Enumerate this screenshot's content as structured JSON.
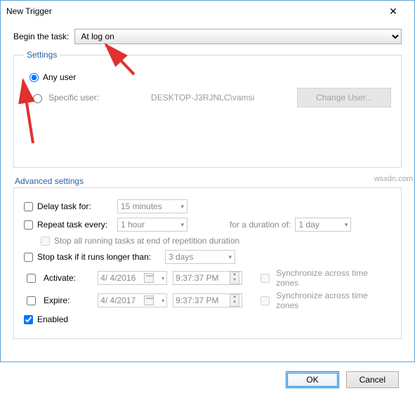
{
  "window": {
    "title": "New Trigger"
  },
  "begin": {
    "label": "Begin the task:",
    "selected": "At log on"
  },
  "settings": {
    "legend": "Settings",
    "any_user_label": "Any user",
    "any_user_checked": true,
    "specific_user_label": "Specific user:",
    "specific_user_checked": false,
    "specific_user_value": "DESKTOP-J3RJNLC\\vamsi",
    "change_user_label": "Change User..."
  },
  "advanced": {
    "legend": "Advanced settings",
    "delay": {
      "label": "Delay task for:",
      "checked": false,
      "value": "15 minutes"
    },
    "repeat": {
      "label": "Repeat task every:",
      "checked": false,
      "value": "1 hour",
      "duration_label": "for a duration of:",
      "duration_value": "1 day"
    },
    "stop_end_label": "Stop all running tasks at end of repetition duration",
    "stop_end_checked": false,
    "stop_longer": {
      "label": "Stop task if it runs longer than:",
      "checked": false,
      "value": "3 days"
    },
    "activate": {
      "label": "Activate:",
      "checked": false,
      "date": "4/  4/2016",
      "time": "9:37:37 PM",
      "sync_label": "Synchronize across time zones",
      "sync_checked": false
    },
    "expire": {
      "label": "Expire:",
      "checked": false,
      "date": "4/  4/2017",
      "time": "9:37:37 PM",
      "sync_label": "Synchronize across time zones",
      "sync_checked": false
    },
    "enabled_label": "Enabled",
    "enabled_checked": true
  },
  "buttons": {
    "ok": "OK",
    "cancel": "Cancel"
  },
  "watermark": "wsxdn.com"
}
